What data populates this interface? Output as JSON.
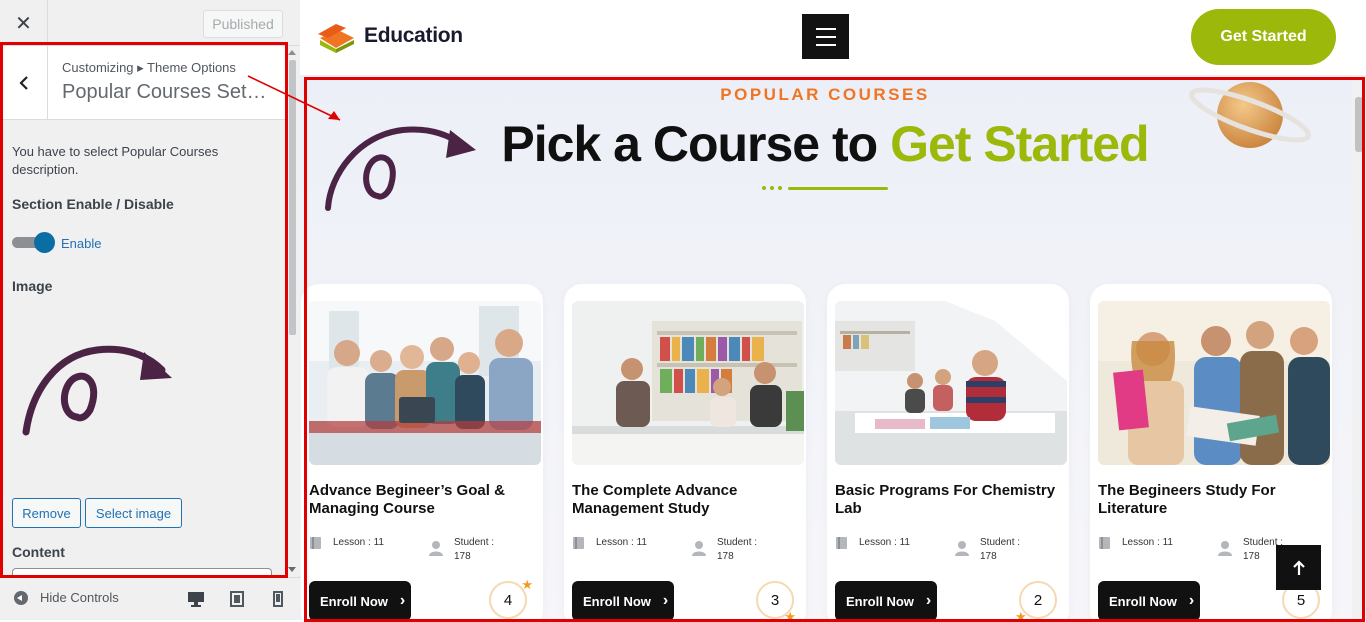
{
  "customizer": {
    "close_label": "✕",
    "published_label": "Published",
    "breadcrumb": "Customizing ▸ Theme Options",
    "panel_title": "Popular Courses Setti…",
    "description": "You have to select Popular Courses description.",
    "section_enable_heading": "Section Enable / Disable",
    "toggle_label": "Enable",
    "toggle_on": true,
    "image_heading": "Image",
    "remove_button": "Remove",
    "select_image_button": "Select image",
    "content_heading": "Content",
    "hide_controls": "Hide Controls"
  },
  "site": {
    "logo_text": "Education",
    "cta_button": "Get Started",
    "brand_color": "#9cb80b",
    "accent_color": "#f07522"
  },
  "section": {
    "subtitle": "POPULAR COURSES",
    "title_main": "Pick a Course to",
    "title_accent": "Get Started"
  },
  "courses": [
    {
      "title": "Advance Begineer’s Goal & Managing Course",
      "lesson": "Lesson : 11",
      "student_label": "Student :",
      "student_count": "178",
      "enroll": "Enroll Now",
      "rating": "4"
    },
    {
      "title": "The Complete Advance Management Study",
      "lesson": "Lesson : 11",
      "student_label": "Student :",
      "student_count": "178",
      "enroll": "Enroll Now",
      "rating": "3"
    },
    {
      "title": "Basic Programs For Chemistry Lab",
      "lesson": "Lesson : 11",
      "student_label": "Student :",
      "student_count": "178",
      "enroll": "Enroll Now",
      "rating": "2"
    },
    {
      "title": "The Begineers Study For Literature",
      "lesson": "Lesson : 11",
      "student_label": "Student :",
      "student_count": "178",
      "enroll": "Enroll Now",
      "rating": "5"
    }
  ]
}
